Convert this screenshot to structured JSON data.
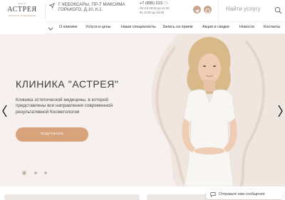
{
  "logo": {
    "top_line": "ЦЕНТР",
    "name": "АСТРЕЯ",
    "tagline": "КРАСОТЫ И ЗДОРОВЬЯ"
  },
  "address": {
    "text": "Г.ЧЕБОКСАРЫ, ПР-Т МАКСИМА ГОРЬКОГО, Д.10, К.1."
  },
  "contacts": {
    "phone_main": "+7 (835) 223",
    "phone_faded": "-71",
    "hours_weekday": "Пн-Сб 09:00 до 21:00",
    "hours_sunday": "Вс 10:00 до 16:00"
  },
  "social": {
    "telegram_icon": "telegram-icon",
    "whatsapp_icon": "whatsapp-icon"
  },
  "search": {
    "placeholder": "Найти услугу"
  },
  "nav": {
    "items": [
      {
        "label": "О клинике"
      },
      {
        "label": "Услуги и цены"
      },
      {
        "label": "Наши специалисты"
      },
      {
        "label": "Запись на прием"
      },
      {
        "label": "Акции и скидки"
      },
      {
        "label": "Новости"
      },
      {
        "label": "Контакты"
      }
    ]
  },
  "hero": {
    "title": "КЛИНИКА \"АСТРЕЯ\"",
    "text": "Клиника эстетической медицины, в которой представлены все направления современной результативной Косметологии",
    "button_label": "ПОДРОБНЕЕ",
    "slides_total": 3,
    "active_slide": 1
  },
  "widget": {
    "label": "Отправьте нам сообщение"
  },
  "colors": {
    "accent": "#d8a37b",
    "hero_bg": "#f6f1ee",
    "social": "#c9a58f"
  }
}
